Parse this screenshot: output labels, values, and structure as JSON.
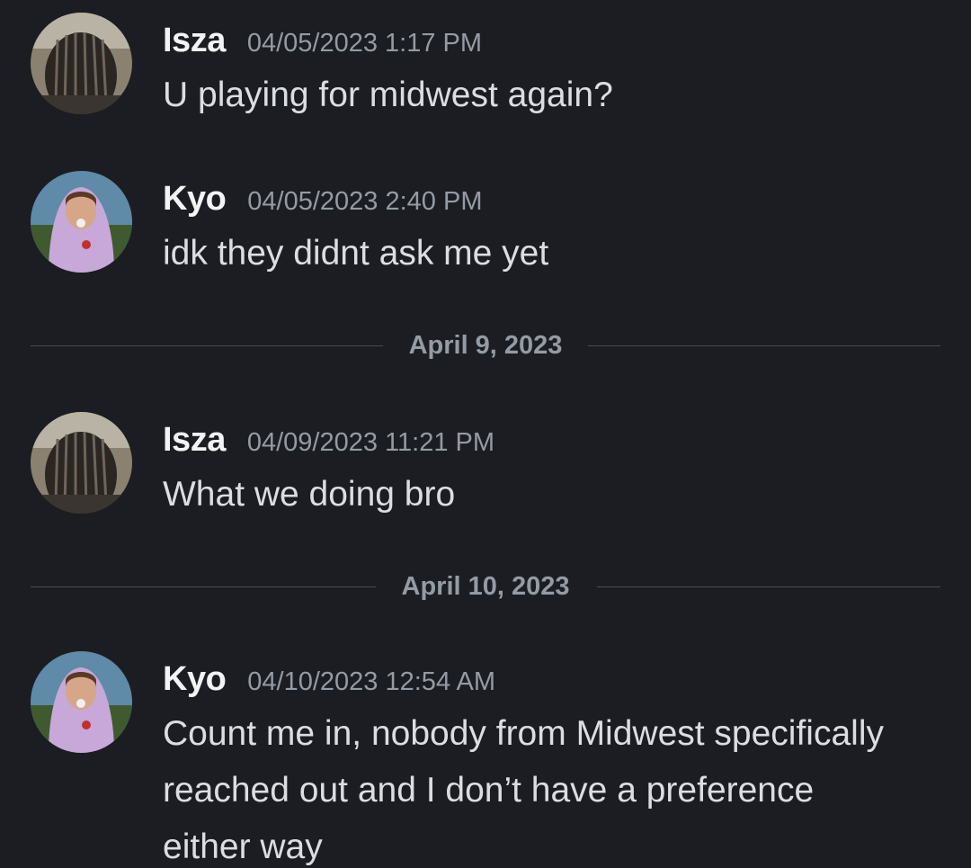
{
  "messages": [
    {
      "author": "Isza",
      "avatar": "isza-avatar",
      "timestamp": "04/05/2023 1:17 PM",
      "text": "U playing for midwest again?"
    },
    {
      "author": "Kyo",
      "avatar": "kyo-avatar",
      "timestamp": "04/05/2023 2:40 PM",
      "text": "idk they didnt ask me yet"
    },
    {
      "author": "Isza",
      "avatar": "isza-avatar",
      "timestamp": "04/09/2023 11:21 PM",
      "text": "What we doing bro"
    },
    {
      "author": "Kyo",
      "avatar": "kyo-avatar",
      "timestamp": "04/10/2023 12:54 AM",
      "text": "Count me in, nobody from Midwest specifically reached out and I don’t have a preference either way"
    }
  ],
  "dividers": [
    {
      "label": "April 9, 2023"
    },
    {
      "label": "April 10, 2023"
    }
  ],
  "colors": {
    "background": "#1c1d22",
    "username": "#f2f3f5",
    "timestamp": "#949ba4",
    "message_text": "#dbdee1",
    "divider_line": "#4a4c53"
  }
}
